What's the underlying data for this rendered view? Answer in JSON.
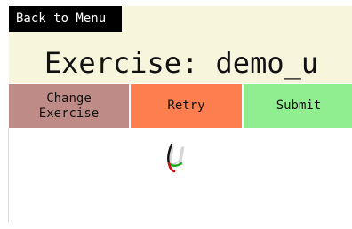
{
  "header": {
    "back_label": "Back to Menu",
    "title": "Exercise: demo_u"
  },
  "toolbar": {
    "change_label": "Change\nExercise",
    "retry_label": "Retry",
    "submit_label": "Submit"
  },
  "drawing": {
    "guide_letter": "u",
    "stroke_colors": [
      "#cc1111",
      "#22aa22",
      "#111111"
    ]
  }
}
